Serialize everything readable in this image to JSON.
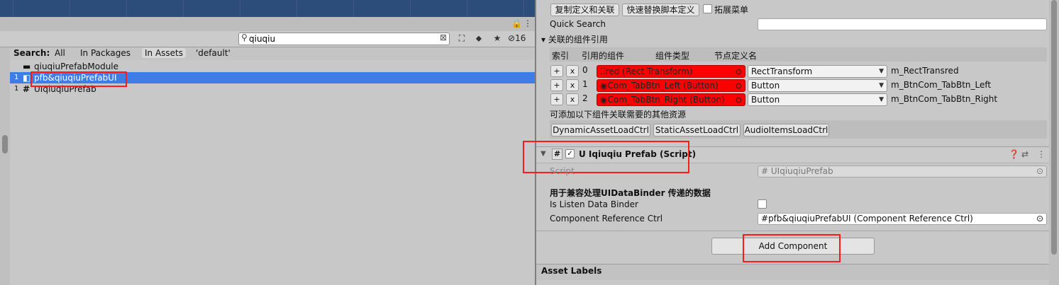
{
  "project": {
    "search": {
      "value": "qiuqiu"
    },
    "hidden_count": "16",
    "scope": {
      "label": "Search:",
      "all": "All",
      "in_packages": "In Packages",
      "in_assets": "In Assets",
      "default": "'default'"
    },
    "items": [
      {
        "num": "",
        "icon": "folder-icon",
        "label": "qiuqiuPrefabModule"
      },
      {
        "num": "1",
        "icon": "prefab-icon",
        "label": "pfb&qiuqiuPrefabUI",
        "selected": true
      },
      {
        "num": "1",
        "icon": "script-icon",
        "label": "UIqiuqiuPrefab"
      }
    ]
  },
  "inspector": {
    "top_buttons": {
      "copy_def": "复制定义和关联",
      "replace_script": "快速替换脚本定义",
      "expand_menu": "拓展菜单"
    },
    "quick_search": "Quick Search",
    "refs_section": "关联的组件引用",
    "table_headers": {
      "index": "索引",
      "component": "引用的组件",
      "type": "组件类型",
      "node_name": "节点定义名"
    },
    "refs": [
      {
        "index": "0",
        "object": "red (Rect Transform)",
        "type": "RectTransform",
        "name": "m_RectTransred"
      },
      {
        "index": "1",
        "object": "Com_TabBtn_Left (Button)",
        "type": "Button",
        "name": "m_BtnCom_TabBtn_Left"
      },
      {
        "index": "2",
        "object": "Com_TabBtn_Right (Button)",
        "type": "Button",
        "name": "m_BtnCom_TabBtn_Right"
      }
    ],
    "extra_label": "可添加以下组件关联需要的其他资源",
    "extra_buttons": [
      "DynamicAssetLoadCtrl",
      "StaticAssetLoadCtrl",
      "AudioItemsLoadCtrl"
    ],
    "component": {
      "title": "U Iqiuqiu Prefab (Script)",
      "script_label": "Script",
      "script_value": "UIqiuqiuPrefab",
      "desc": "用于兼容处理UIDataBinder 传递的数据",
      "listen_label": "Is Listen Data Binder",
      "ref_label": "Component Reference Ctrl",
      "ref_value": "pfb&qiuqiuPrefabUI (Component Reference Ctrl)"
    },
    "add_component": "Add Component",
    "asset_labels": "Asset Labels"
  },
  "colors": {
    "selection": "#3e7de7",
    "highlight_box": "#ff1a1a",
    "object_field_red": "#ff0000",
    "scene_bg": "#2c4d7a"
  }
}
